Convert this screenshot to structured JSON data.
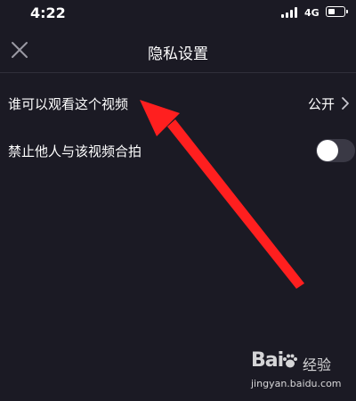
{
  "status_bar": {
    "time": "4:22",
    "network": "4G",
    "battery_level": 0.45
  },
  "nav": {
    "title": "隐私设置",
    "close_icon": "close-icon"
  },
  "settings": [
    {
      "label": "谁可以观看这个视频",
      "value": "公开",
      "icon": "chevron-right-icon"
    },
    {
      "label": "禁止他人与该视频合拍",
      "toggle_on": false
    }
  ],
  "watermark": {
    "brand": "Bai",
    "brand_cn": "经验",
    "url": "jingyan.baidu.com"
  },
  "colors": {
    "background": "#1b1a24",
    "divider": "#302f3a",
    "text": "#ffffff",
    "toggle_track": "#3a3945",
    "annotation_arrow": "#ff1f1f"
  }
}
